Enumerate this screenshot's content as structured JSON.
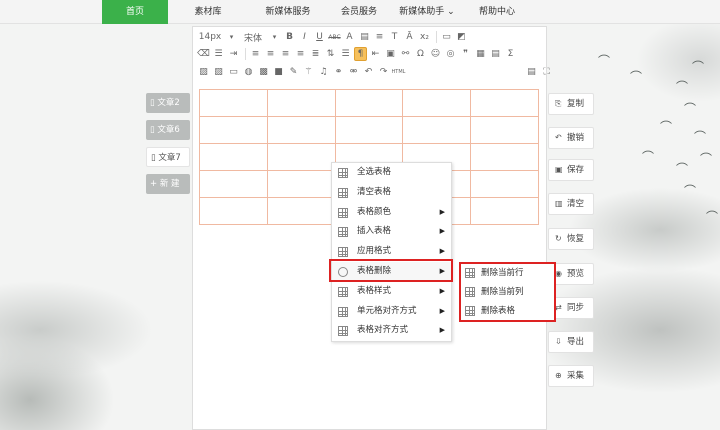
{
  "nav": [
    "首页",
    "素材库",
    "新媒体服务",
    "会员服务",
    "新媒体助手",
    "帮助中心"
  ],
  "nav_dropdown_glyph": "⌄",
  "toolbar": {
    "font_size": "14px",
    "font_family": "宋体",
    "bold": "B",
    "italic": "I",
    "underline": "U",
    "strike": "ABC",
    "font_color": "A",
    "html": "HTML",
    "omega": "Ω",
    "quote": "❞",
    "sigma": "Σ"
  },
  "articles": [
    {
      "label": "文章2",
      "icon": "doc-icon"
    },
    {
      "label": "文章6",
      "icon": "doc-icon"
    },
    {
      "label": "文章7",
      "icon": "doc-icon"
    }
  ],
  "new_button": {
    "plus": "+",
    "label": "新 建"
  },
  "right_actions": [
    {
      "label": "复制",
      "glyph": "⎘"
    },
    {
      "label": "撤销",
      "glyph": "↶"
    },
    {
      "label": "保存",
      "glyph": "▣"
    },
    {
      "label": "清空",
      "glyph": "▥"
    },
    {
      "label": "恢复",
      "glyph": "↻"
    },
    {
      "label": "预览",
      "glyph": "◉"
    },
    {
      "label": "同步",
      "glyph": "⇄"
    },
    {
      "label": "导出",
      "glyph": "⇩"
    },
    {
      "label": "采集",
      "glyph": "⊕"
    }
  ],
  "context_menu": {
    "items": [
      {
        "label": "全选表格",
        "submenu": false
      },
      {
        "label": "清空表格",
        "submenu": false
      },
      {
        "label": "表格颜色",
        "submenu": true
      },
      {
        "label": "插入表格",
        "submenu": true
      },
      {
        "label": "应用格式",
        "submenu": true
      },
      {
        "label": "表格删除",
        "submenu": true
      },
      {
        "label": "表格样式",
        "submenu": true
      },
      {
        "label": "单元格对齐方式",
        "submenu": true
      },
      {
        "label": "表格对齐方式",
        "submenu": true
      }
    ],
    "arrow": "▶"
  },
  "submenu": [
    "删除当前行",
    "删除当前列",
    "删除表格"
  ],
  "table": {
    "rows": 5,
    "cols": 5
  },
  "colors": {
    "accent": "#3bb14a",
    "highlight": "#dd2222",
    "table_border": "#f0b9a1"
  }
}
